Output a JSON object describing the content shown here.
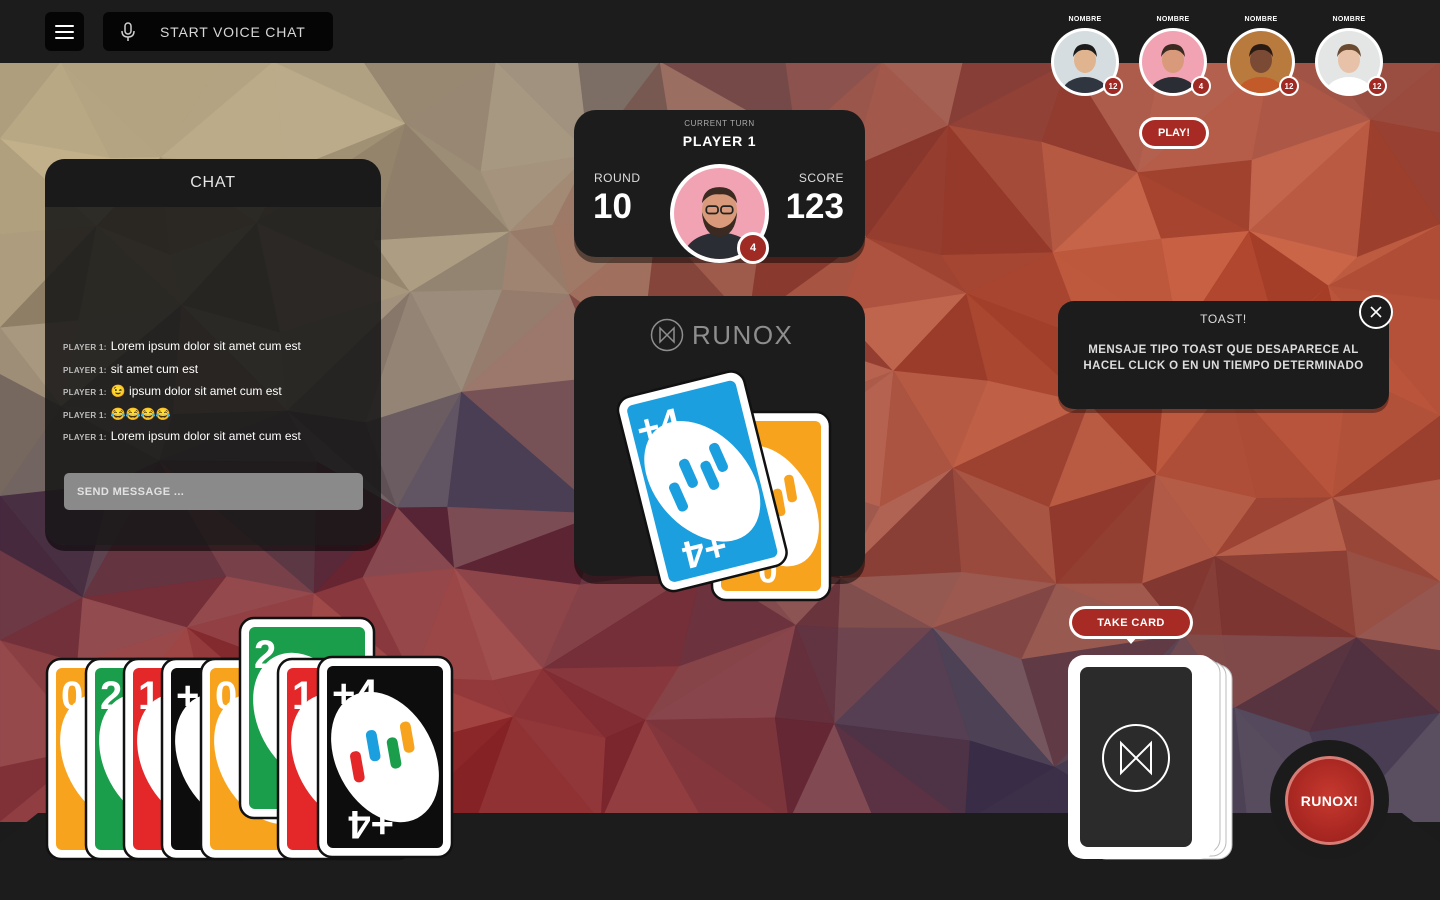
{
  "toolbar": {
    "menu_icon": "hamburger-menu-icon",
    "voice_label": "START VOICE CHAT",
    "voice_icon": "microphone-icon"
  },
  "players": [
    {
      "name": "NOMBRE",
      "cards": "12",
      "skin": "#e0b48f",
      "hair": "#1b1b1b",
      "bg": "#d6dde0",
      "shirt": "#2f3640"
    },
    {
      "name": "NOMBRE",
      "cards": "4",
      "skin": "#d89a7a",
      "hair": "#3a2a22",
      "bg": "#f2a3b3",
      "shirt": "#2a2d33"
    },
    {
      "name": "NOMBRE",
      "cards": "12",
      "skin": "#7a4a34",
      "hair": "#2a1a14",
      "bg": "#b97a3e",
      "shirt": "#c35a2a"
    },
    {
      "name": "NOMBRE",
      "cards": "12",
      "skin": "#e8c2a8",
      "hair": "#6a4a30",
      "bg": "#e3e6e4",
      "shirt": "#ffffff"
    }
  ],
  "play_label": "PLAY!",
  "chat": {
    "title": "CHAT",
    "messages": [
      {
        "who": "PLAYER 1:",
        "text": "Lorem ipsum dolor sit amet cum est"
      },
      {
        "who": "PLAYER 1:",
        "text": "sit amet cum est"
      },
      {
        "who": "PLAYER 1:",
        "text": "😉 ipsum dolor sit amet cum est"
      },
      {
        "who": "PLAYER 1:",
        "text": "😂😂😂😂"
      },
      {
        "who": "PLAYER 1:",
        "text": "Lorem ipsum dolor sit amet cum est"
      }
    ],
    "input_placeholder": "SEND MESSAGE ..."
  },
  "turn": {
    "caption": "CURRENT TURN",
    "player": "PLAYER 1",
    "round_label": "ROUND",
    "round_value": "10",
    "score_label": "SCORE",
    "score_value": "123",
    "player_cards": "4"
  },
  "logo": "RUNOX",
  "toast": {
    "title": "TOAST!",
    "body": "MENSAJE TIPO TOAST QUE DESAPARECE AL HACEL CLICK O EN UN TIEMPO DETERMINADO",
    "close_icon": "close-icon"
  },
  "take_card_label": "TAKE CARD",
  "runox_button": "RUNOX!",
  "discard_pile": [
    {
      "label": "+4",
      "color": "#1b9fdf"
    },
    {
      "label": "0",
      "color": "#f8a31e"
    }
  ],
  "hand": [
    {
      "label": "0",
      "color": "#f8a31e"
    },
    {
      "label": "2",
      "color": "#1a9e4b"
    },
    {
      "label": "1",
      "color": "#e4282a"
    },
    {
      "label": "+4",
      "color": "#0d0d0d"
    },
    {
      "label": "0",
      "color": "#f8a31e"
    },
    {
      "label": "2",
      "color": "#1a9e4b"
    },
    {
      "label": "1",
      "color": "#e4282a"
    },
    {
      "label": "+4",
      "color": "#0d0d0d"
    }
  ],
  "colors": {
    "accent_red": "#a82a24",
    "panel": "#1c1c1c",
    "card_yellow": "#f8a31e",
    "card_green": "#1a9e4b",
    "card_red": "#e4282a",
    "card_blue": "#1b9fdf",
    "card_black": "#0d0d0d"
  }
}
